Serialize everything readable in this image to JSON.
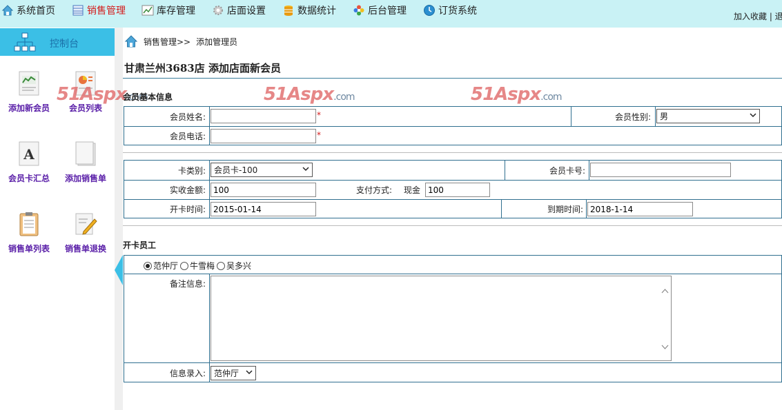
{
  "nav": {
    "items": [
      {
        "label": "系统首页",
        "icon": "house-icon"
      },
      {
        "label": "销售管理",
        "icon": "spreadsheet-icon",
        "active": true
      },
      {
        "label": "库存管理",
        "icon": "line-chart-icon"
      },
      {
        "label": "店面设置",
        "icon": "gear-icon"
      },
      {
        "label": "数据统计",
        "icon": "database-icon"
      },
      {
        "label": "后台管理",
        "icon": "flower-icon"
      },
      {
        "label": "订货系统",
        "icon": "clock-icon"
      }
    ],
    "right_text": "加入收藏 | 退"
  },
  "sidebar": {
    "console_label": "控制台",
    "items": [
      {
        "label": "添加新会员",
        "icon": "report-chart-icon"
      },
      {
        "label": "会员列表",
        "icon": "presentation-icon"
      },
      {
        "label": "会员卡汇总",
        "icon": "font-a-icon"
      },
      {
        "label": "添加销售单",
        "icon": "blank-document-icon"
      },
      {
        "label": "销售单列表",
        "icon": "clipboard-icon"
      },
      {
        "label": "销售单退换",
        "icon": "edit-pencil-icon"
      }
    ]
  },
  "breadcrumb": {
    "section": "销售管理>>",
    "page": "添加管理员"
  },
  "page_title": "甘肃兰州3683店 添加店面新会员",
  "watermark": {
    "brand": "51Aspx",
    "suffix": ".com"
  },
  "section_basic": "会员基本信息",
  "form": {
    "name_label": "会员姓名:",
    "name_value": "",
    "gender_label": "会员性别:",
    "gender_value": "男",
    "phone_label": "会员电话:",
    "phone_value": "",
    "required_mark": "*",
    "card_type_label": "卡类别:",
    "card_type_value": "会员卡-100",
    "card_no_label": "会员卡号:",
    "card_no_value": "",
    "amount_label": "实收金额:",
    "amount_value": "100",
    "pay_method_label": "支付方式:",
    "pay_method_name": "现金",
    "pay_method_value": "100",
    "open_date_label": "开卡时间:",
    "open_date_value": "2015-01-14",
    "expire_label": "到期时间:",
    "expire_value": "2018-1-14"
  },
  "section_staff": "开卡员工",
  "staff": {
    "options": [
      "范仲厅",
      "牛雪梅",
      "吴多兴"
    ],
    "selected": "范仲厅"
  },
  "remarks_label": "备注信息:",
  "remarks_value": "",
  "entry_label": "信息录入:",
  "entry_value": "范仲厅"
}
